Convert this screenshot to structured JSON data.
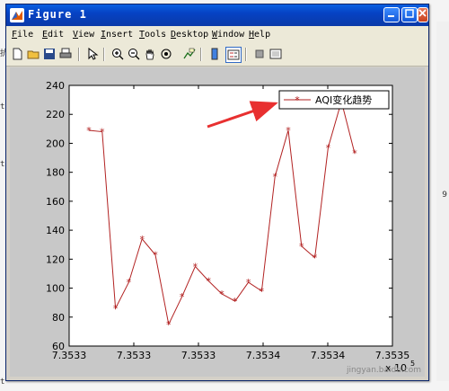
{
  "window": {
    "title": "Figure 1"
  },
  "menu": [
    {
      "label": "File",
      "u": "F",
      "rest": "ile"
    },
    {
      "label": "Edit",
      "u": "E",
      "rest": "dit"
    },
    {
      "label": "View",
      "u": "V",
      "rest": "iew"
    },
    {
      "label": "Insert",
      "u": "I",
      "rest": "nsert"
    },
    {
      "label": "Tools",
      "u": "T",
      "rest": "ools"
    },
    {
      "label": "Desktop",
      "u": "D",
      "rest": "esktop"
    },
    {
      "label": "Window",
      "u": "W",
      "rest": "indow"
    },
    {
      "label": "Help",
      "u": "H",
      "rest": "elp"
    }
  ],
  "toolbar": [
    "new-figure-icon",
    "open-file-icon",
    "save-icon",
    "print-icon",
    "pointer-icon",
    "zoom-in-icon",
    "zoom-out-icon",
    "pan-hand-icon",
    "rotate-3d-icon",
    "data-cursor-icon",
    "colorbar-icon",
    "legend-icon",
    "hide-plot-tools-icon",
    "show-plot-tools-icon"
  ],
  "chart_data": {
    "type": "line",
    "series": [
      {
        "name": "AQI变化趋势",
        "color": "#b22222",
        "marker": "asterisk",
        "values": [
          209,
          208,
          86,
          104,
          134,
          123,
          75,
          94,
          115,
          105,
          96,
          91,
          104,
          98,
          177,
          209,
          129,
          121,
          197,
          229,
          193
        ]
      }
    ],
    "x_tick_labels": [
      "7.3533",
      "7.3533",
      "7.3533",
      "7.3534",
      "7.3534",
      "7.3535"
    ],
    "x_exponent": "x 10",
    "x_exponent_power": "5",
    "ylim": [
      60,
      240
    ],
    "yticks": [
      60,
      80,
      100,
      120,
      140,
      160,
      180,
      200,
      220,
      240
    ],
    "legend_position": "top-right",
    "grid": false
  },
  "backdrop": {
    "left_marks": [
      "抗",
      "t",
      "t",
      "t"
    ],
    "right_mark": "9"
  },
  "watermark": "jingyan.baidu.com"
}
